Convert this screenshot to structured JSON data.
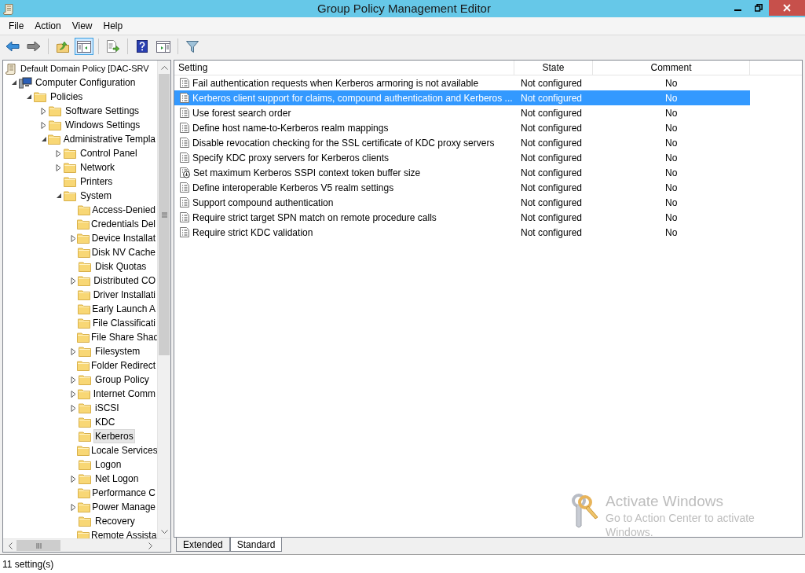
{
  "window": {
    "title": "Group Policy Management Editor"
  },
  "menu": [
    "File",
    "Action",
    "View",
    "Help"
  ],
  "toolbar": [
    [
      {
        "kind": "back",
        "pressed": false
      },
      {
        "kind": "forward",
        "pressed": false
      }
    ],
    [
      {
        "kind": "up",
        "pressed": false
      },
      {
        "kind": "tree",
        "pressed": true
      }
    ],
    [
      {
        "kind": "export",
        "pressed": false
      }
    ],
    [
      {
        "kind": "help",
        "pressed": false
      },
      {
        "kind": "pane",
        "pressed": false
      }
    ],
    [
      {
        "kind": "filter",
        "pressed": false
      }
    ]
  ],
  "tree": [
    {
      "label": "Default Domain Policy [DAC-SRV",
      "kind": "policy",
      "selected": false,
      "children": [
        {
          "label": "Computer Configuration",
          "kind": "computer",
          "expanded": true,
          "selected": false,
          "children": [
            {
              "label": "Policies",
              "kind": "folder",
              "expanded": true,
              "selected": false,
              "children": [
                {
                  "label": "Software Settings",
                  "kind": "folder",
                  "expanded": false,
                  "selected": false
                },
                {
                  "label": "Windows Settings",
                  "kind": "folder",
                  "expanded": false,
                  "selected": false
                },
                {
                  "label": "Administrative Templa",
                  "kind": "folder",
                  "expanded": true,
                  "selected": false,
                  "children": [
                    {
                      "label": "Control Panel",
                      "kind": "folder",
                      "expanded": false,
                      "selected": false
                    },
                    {
                      "label": "Network",
                      "kind": "folder",
                      "expanded": false,
                      "selected": false
                    },
                    {
                      "label": "Printers",
                      "kind": "folder",
                      "selected": false
                    },
                    {
                      "label": "System",
                      "kind": "folder",
                      "expanded": true,
                      "selected": false,
                      "children": [
                        {
                          "label": "Access-Denied",
                          "kind": "folder",
                          "selected": false
                        },
                        {
                          "label": "Credentials Del",
                          "kind": "folder",
                          "selected": false
                        },
                        {
                          "label": "Device Installat",
                          "kind": "folder",
                          "expanded": false,
                          "selected": false
                        },
                        {
                          "label": "Disk NV Cache",
                          "kind": "folder",
                          "selected": false
                        },
                        {
                          "label": "Disk Quotas",
                          "kind": "folder",
                          "selected": false
                        },
                        {
                          "label": "Distributed CO",
                          "kind": "folder",
                          "expanded": false,
                          "selected": false
                        },
                        {
                          "label": "Driver Installati",
                          "kind": "folder",
                          "selected": false
                        },
                        {
                          "label": "Early Launch A",
                          "kind": "folder",
                          "selected": false
                        },
                        {
                          "label": "File Classificati",
                          "kind": "folder",
                          "selected": false
                        },
                        {
                          "label": "File Share Shad",
                          "kind": "folder",
                          "selected": false
                        },
                        {
                          "label": "Filesystem",
                          "kind": "folder",
                          "expanded": false,
                          "selected": false
                        },
                        {
                          "label": "Folder Redirect",
                          "kind": "folder",
                          "selected": false
                        },
                        {
                          "label": "Group Policy",
                          "kind": "folder",
                          "expanded": false,
                          "selected": false
                        },
                        {
                          "label": "Internet Comm",
                          "kind": "folder",
                          "expanded": false,
                          "selected": false
                        },
                        {
                          "label": "iSCSI",
                          "kind": "folder",
                          "expanded": false,
                          "selected": false
                        },
                        {
                          "label": "KDC",
                          "kind": "folder",
                          "selected": false
                        },
                        {
                          "label": "Kerberos",
                          "kind": "folder",
                          "selected": true
                        },
                        {
                          "label": "Locale Services",
                          "kind": "folder",
                          "selected": false
                        },
                        {
                          "label": "Logon",
                          "kind": "folder",
                          "selected": false
                        },
                        {
                          "label": "Net Logon",
                          "kind": "folder",
                          "expanded": false,
                          "selected": false
                        },
                        {
                          "label": "Performance C",
                          "kind": "folder",
                          "selected": false
                        },
                        {
                          "label": "Power Manage",
                          "kind": "folder",
                          "expanded": false,
                          "selected": false
                        },
                        {
                          "label": "Recovery",
                          "kind": "folder",
                          "selected": false
                        },
                        {
                          "label": "Remote Assista",
                          "kind": "folder",
                          "selected": false
                        }
                      ]
                    }
                  ]
                }
              ]
            }
          ]
        }
      ]
    }
  ],
  "table": {
    "columns": [
      "Setting",
      "State",
      "Comment"
    ],
    "rows": [
      {
        "kind": "policy",
        "setting": "Fail authentication requests when Kerberos armoring is not available",
        "state": "Not configured",
        "comment": "No",
        "selected": false
      },
      {
        "kind": "policy",
        "setting": "Kerberos client support for claims, compound authentication and Kerberos ...",
        "state": "Not configured",
        "comment": "No",
        "selected": true
      },
      {
        "kind": "policy",
        "setting": "Use forest search order",
        "state": "Not configured",
        "comment": "No",
        "selected": false
      },
      {
        "kind": "policy",
        "setting": "Define host name-to-Kerberos realm mappings",
        "state": "Not configured",
        "comment": "No",
        "selected": false
      },
      {
        "kind": "policy",
        "setting": "Disable revocation checking for the SSL certificate of KDC proxy servers",
        "state": "Not configured",
        "comment": "No",
        "selected": false
      },
      {
        "kind": "policy",
        "setting": "Specify KDC proxy servers for Kerberos clients",
        "state": "Not configured",
        "comment": "No",
        "selected": false
      },
      {
        "kind": "download",
        "setting": "Set maximum Kerberos SSPI context token buffer size",
        "state": "Not configured",
        "comment": "No",
        "selected": false
      },
      {
        "kind": "policy",
        "setting": "Define interoperable Kerberos V5 realm settings",
        "state": "Not configured",
        "comment": "No",
        "selected": false
      },
      {
        "kind": "policy",
        "setting": "Support compound authentication",
        "state": "Not configured",
        "comment": "No",
        "selected": false
      },
      {
        "kind": "policy",
        "setting": "Require strict target SPN match on remote procedure calls",
        "state": "Not configured",
        "comment": "No",
        "selected": false
      },
      {
        "kind": "policy",
        "setting": "Require strict KDC validation",
        "state": "Not configured",
        "comment": "No",
        "selected": false
      }
    ]
  },
  "view_tabs": [
    {
      "label": "Extended",
      "selected": false
    },
    {
      "label": "Standard",
      "selected": true
    }
  ],
  "activation_notice": {
    "title": "Activate Windows",
    "message": "Go to Action Center to activate",
    "message_cut": "Windows."
  },
  "status_bar": "11 setting(s)"
}
